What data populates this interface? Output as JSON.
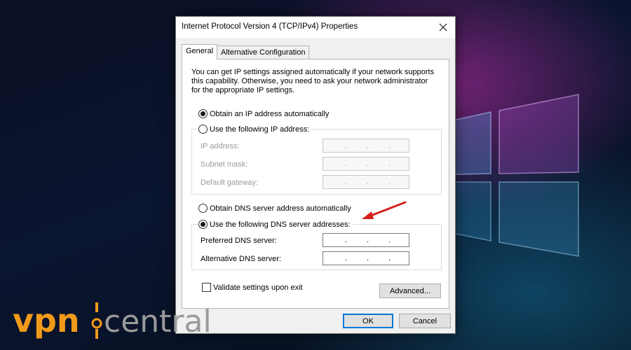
{
  "dialog": {
    "title": "Internet Protocol Version 4 (TCP/IPv4) Properties",
    "tabs": [
      {
        "label": "General",
        "active": true
      },
      {
        "label": "Alternative Configuration",
        "active": false
      }
    ],
    "description": "You can get IP settings assigned automatically if your network supports this capability. Otherwise, you need to ask your network administrator for the appropriate IP settings.",
    "ip": {
      "auto_label": "Obtain an IP address automatically",
      "manual_label": "Use the following IP address:",
      "selected": "auto",
      "fields": [
        {
          "label": "IP address:",
          "value": ". . ."
        },
        {
          "label": "Subnet mask:",
          "value": ". . ."
        },
        {
          "label": "Default gateway:",
          "value": ". . ."
        }
      ]
    },
    "dns": {
      "auto_label": "Obtain DNS server address automatically",
      "manual_label": "Use the following DNS server addresses:",
      "selected": "manual",
      "fields": [
        {
          "label": "Preferred DNS server:",
          "value": ". . ."
        },
        {
          "label": "Alternative DNS server:",
          "value": ". . ."
        }
      ]
    },
    "validate_label": "Validate settings upon exit",
    "validate_checked": false,
    "advanced_label": "Advanced...",
    "ok_label": "OK",
    "cancel_label": "Cancel"
  },
  "watermark": {
    "brand_left": "vpn",
    "brand_right": "central"
  },
  "colors": {
    "arrow": "#d42020",
    "logo_orange": "#f29a1a",
    "logo_gray": "#9a9a9a",
    "focus": "#0078d7"
  }
}
